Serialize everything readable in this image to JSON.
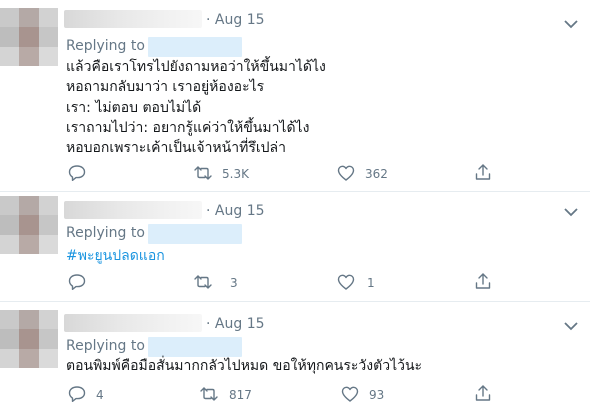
{
  "tweets": [
    {
      "date": "· Aug 15",
      "replying_to": "Replying to",
      "lines": [
        "แล้วคือเราโทรไปยังถามหอว่าให้ขึ้นมาได้ไง",
        "หอถามกลับมาว่า เราอยู่ห้องอะไร",
        "เรา: ไม่ตอบ ตอบไม่ได้",
        "เราถามไปว่า: อยากรู้แค่ว่าให้ขึ้นมาได้ไง",
        "หอบอกเพราะเค้าเป็นเจ้าหน้าที่รึเปล่า"
      ],
      "replies": "",
      "retweets": "5.3K",
      "likes": "362"
    },
    {
      "date": "· Aug 15",
      "replying_to": "Replying to",
      "hashtag": "#พะยูนปลดแอก",
      "replies": "",
      "retweets": "3",
      "likes": "1"
    },
    {
      "date": "· Aug 15",
      "replying_to": "Replying to",
      "lines": [
        "ตอนพิมพ์คือมือสั่นมากกลัวไปหมด ขอให้ทุกคนระวังตัวไว้นะ"
      ],
      "replies": "4",
      "retweets": "817",
      "likes": "93"
    }
  ],
  "icons": {
    "more": "chevron-down-icon",
    "reply": "reply-icon",
    "retweet": "retweet-icon",
    "like": "heart-icon",
    "share": "share-icon"
  },
  "colors": {
    "text": "#14171a",
    "muted": "#657786",
    "link": "#1b95e0",
    "divider": "#e6ecf0"
  }
}
